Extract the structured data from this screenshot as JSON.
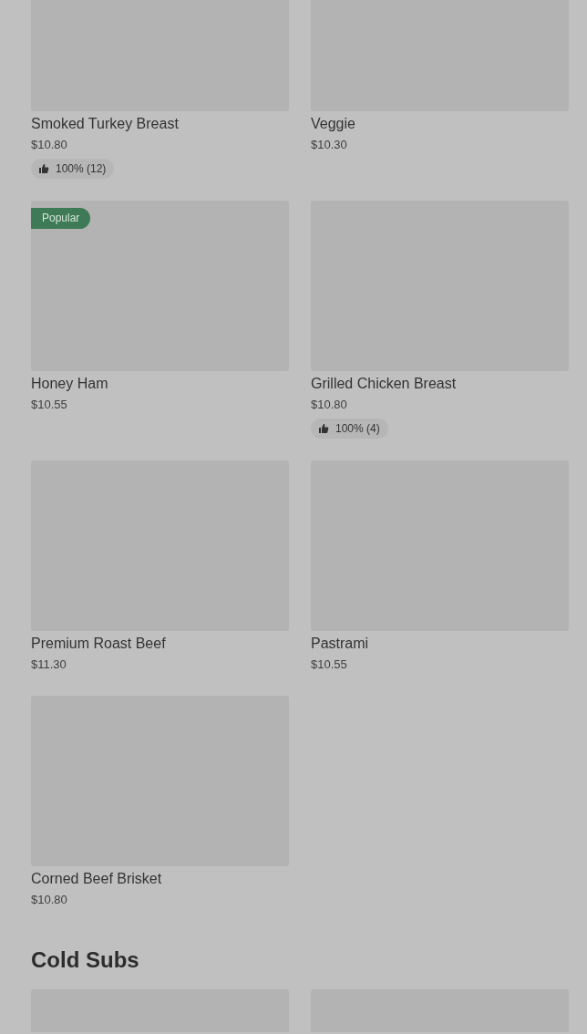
{
  "sections": [
    {
      "items": [
        {
          "name": "Smoked Turkey Breast",
          "price": "$10.80",
          "rating": "100% (12)"
        },
        {
          "name": "Veggie",
          "price": "$10.30"
        },
        {
          "name": "Honey Ham",
          "price": "$10.55",
          "tag": "Popular"
        },
        {
          "name": "Grilled Chicken Breast",
          "price": "$10.80",
          "rating": "100% (4)"
        },
        {
          "name": "Premium Roast Beef",
          "price": "$11.30"
        },
        {
          "name": "Pastrami",
          "price": "$10.55"
        },
        {
          "name": "Corned Beef Brisket",
          "price": "$10.80"
        }
      ]
    },
    {
      "title": "Cold Subs"
    }
  ]
}
